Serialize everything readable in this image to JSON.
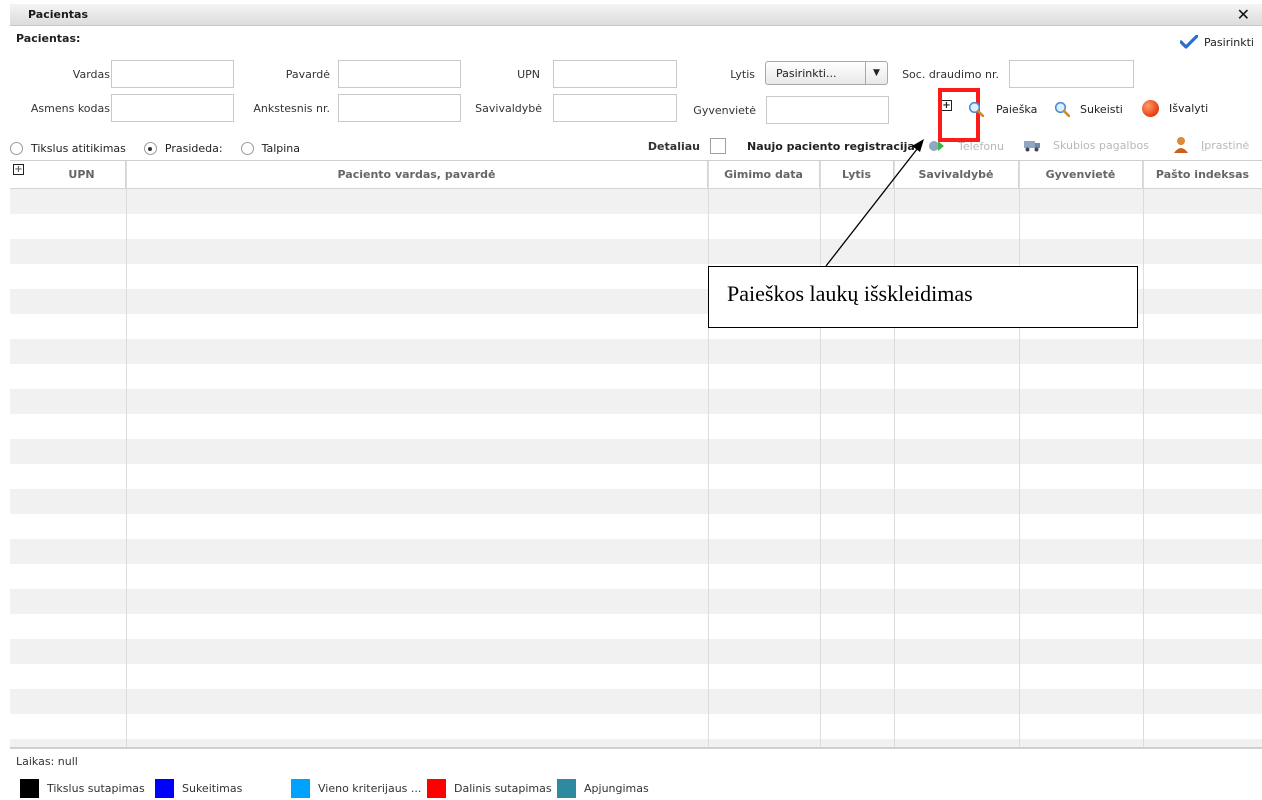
{
  "window": {
    "title": "Pacientas"
  },
  "section": {
    "label": "Pacientas:"
  },
  "actions": {
    "select_label": "Pasirinkti",
    "search_label": "Paieška",
    "swap_label": "Sukeisti",
    "clear_label": "Išvalyti",
    "phone_label": "Telefonu",
    "emergency_label": "Skubios pagalbos",
    "usual_label": "Įprastinė",
    "expand_symbol": "+"
  },
  "fields": {
    "first_name": {
      "label": "Vardas",
      "value": ""
    },
    "last_name": {
      "label": "Pavardė",
      "value": ""
    },
    "upn": {
      "label": "UPN",
      "value": ""
    },
    "gender": {
      "label": "Lytis",
      "selected": "Pasirinkti..."
    },
    "insurance": {
      "label": "Soc. draudimo nr.",
      "value": ""
    },
    "personal_code": {
      "label": "Asmens kodas",
      "value": ""
    },
    "previous_no": {
      "label": "Ankstesnis nr.",
      "value": ""
    },
    "municipality": {
      "label": "Savivaldybė",
      "value": ""
    },
    "residence": {
      "label": "Gyvenvietė",
      "value": ""
    }
  },
  "match_modes": {
    "options": [
      "Tikslus atitikimas",
      "Prasideda:",
      "Talpina"
    ],
    "selected": "Prasideda:"
  },
  "detail": {
    "label": "Detaliau"
  },
  "registration": {
    "label": "Naujo paciento registracija"
  },
  "grid": {
    "columns": [
      "UPN",
      "Paciento vardas, pavardė",
      "Gimimo data",
      "Lytis",
      "Savivaldybė",
      "Gyvenvietė",
      "Pašto indeksas"
    ],
    "rows": []
  },
  "footer": {
    "time_label": "Laikas: null"
  },
  "legend": [
    {
      "label": "Tikslus sutapimas",
      "color": "#000000"
    },
    {
      "label": "Sukeitimas",
      "color": "#0000ff"
    },
    {
      "label": "Vieno kriterijaus ...",
      "color": "#00a2ff"
    },
    {
      "label": "Dalinis sutapimas",
      "color": "#ff0000"
    },
    {
      "label": "Apjungimas",
      "color": "#2f8aa0"
    }
  ],
  "annotation": {
    "text": "Paieškos laukų išskleidimas",
    "highlight_color": "#ff1a1a"
  }
}
